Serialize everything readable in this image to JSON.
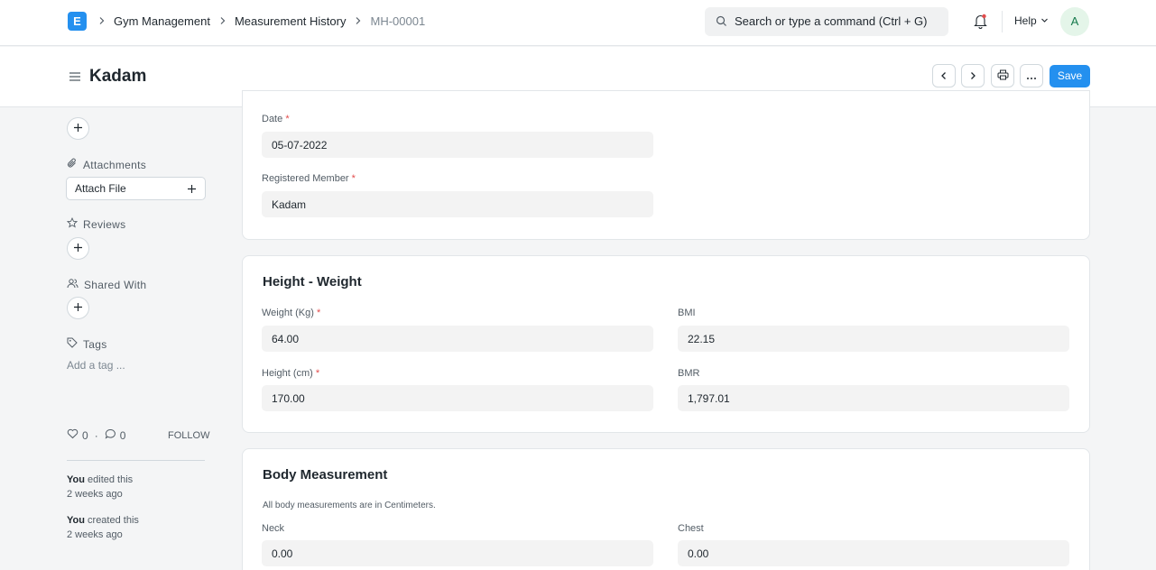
{
  "navbar": {
    "logo_letter": "E",
    "breadcrumbs": [
      "Gym Management",
      "Measurement History"
    ],
    "current": "MH-00001",
    "search_placeholder": "Search or type a command (Ctrl + G)",
    "help_label": "Help",
    "avatar_letter": "A"
  },
  "page": {
    "title": "Kadam",
    "save_label": "Save"
  },
  "sidebar": {
    "attachments_label": "Attachments",
    "attach_file_label": "Attach File",
    "reviews_label": "Reviews",
    "shared_with_label": "Shared With",
    "tags_label": "Tags",
    "add_tag_label": "Add a tag ...",
    "likes_count": "0",
    "dot": "·",
    "comments_count": "0",
    "follow_label": "FOLLOW",
    "activity": [
      {
        "user": "You",
        "action": "edited this",
        "time": "2 weeks ago"
      },
      {
        "user": "You",
        "action": "created this",
        "time": "2 weeks ago"
      }
    ]
  },
  "details": {
    "date_label": "Date",
    "date_value": "05-07-2022",
    "member_label": "Registered Member",
    "member_value": "Kadam",
    "required_mark": "*"
  },
  "height_weight": {
    "title": "Height - Weight",
    "weight_label": "Weight (Kg)",
    "weight_value": "64.00",
    "height_label": "Height (cm)",
    "height_value": "170.00",
    "bmi_label": "BMI",
    "bmi_value": "22.15",
    "bmr_label": "BMR",
    "bmr_value": "1,797.01"
  },
  "body_measurement": {
    "title": "Body Measurement",
    "description": "All body measurements are in Centimeters.",
    "neck_label": "Neck",
    "neck_value": "0.00",
    "chest_label": "Chest",
    "chest_value": "0.00"
  }
}
